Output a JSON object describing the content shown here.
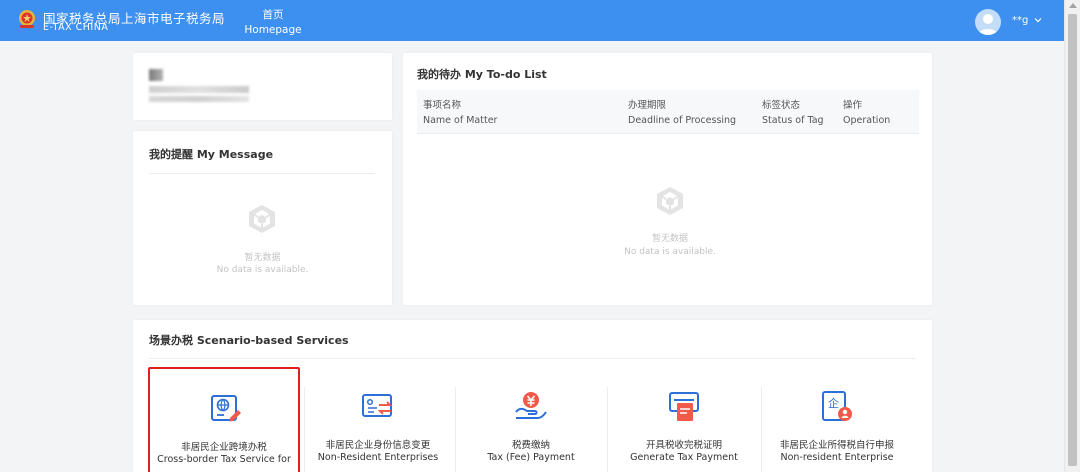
{
  "header": {
    "brand_cn": "国家税务总局上海市电子税务局",
    "brand_en": "E-TAX CHINA",
    "nav_home_cn": "首页",
    "nav_home_en": "Homepage",
    "user_name": "**g",
    "brand_color": "#3d8ff0"
  },
  "message": {
    "title": "我的提醒 My Message",
    "empty_cn": "暂无数据",
    "empty_en": "No data is available."
  },
  "todo": {
    "title": "我的待办 My To-do List",
    "columns": [
      {
        "cn": "事项名称",
        "en": "Name of Matter"
      },
      {
        "cn": "办理期限",
        "en": "Deadline of Processing"
      },
      {
        "cn": "标签状态",
        "en": "Status of Tag"
      },
      {
        "cn": "操作",
        "en": "Operation"
      }
    ],
    "empty_cn": "暂无数据",
    "empty_en": "No data is available."
  },
  "services": {
    "title": "场景办税 Scenario-based Services",
    "items": [
      {
        "cn": "非居民企业跨境办税",
        "en": "Cross-border Tax Service for",
        "icon": "globe-document-icon",
        "selected": true
      },
      {
        "cn": "非居民企业身份信息变更",
        "en": "Non-Resident Enterprises",
        "icon": "id-card-exchange-icon",
        "selected": false
      },
      {
        "cn": "税费缴纳",
        "en": "Tax (Fee) Payment",
        "icon": "yuan-coin-hand-icon",
        "selected": false
      },
      {
        "cn": "开具税收完税证明",
        "en": "Generate Tax Payment",
        "icon": "printer-certificate-icon",
        "selected": false
      },
      {
        "cn": "非居民企业所得税自行申报",
        "en": "Non-resident Enterprise",
        "icon": "enterprise-user-icon",
        "selected": false
      }
    ]
  },
  "colors": {
    "accent": "#3d8ff0",
    "icon_blue": "#2d6fd8",
    "icon_red": "#f05a4a",
    "selected_border": "#e02020"
  }
}
